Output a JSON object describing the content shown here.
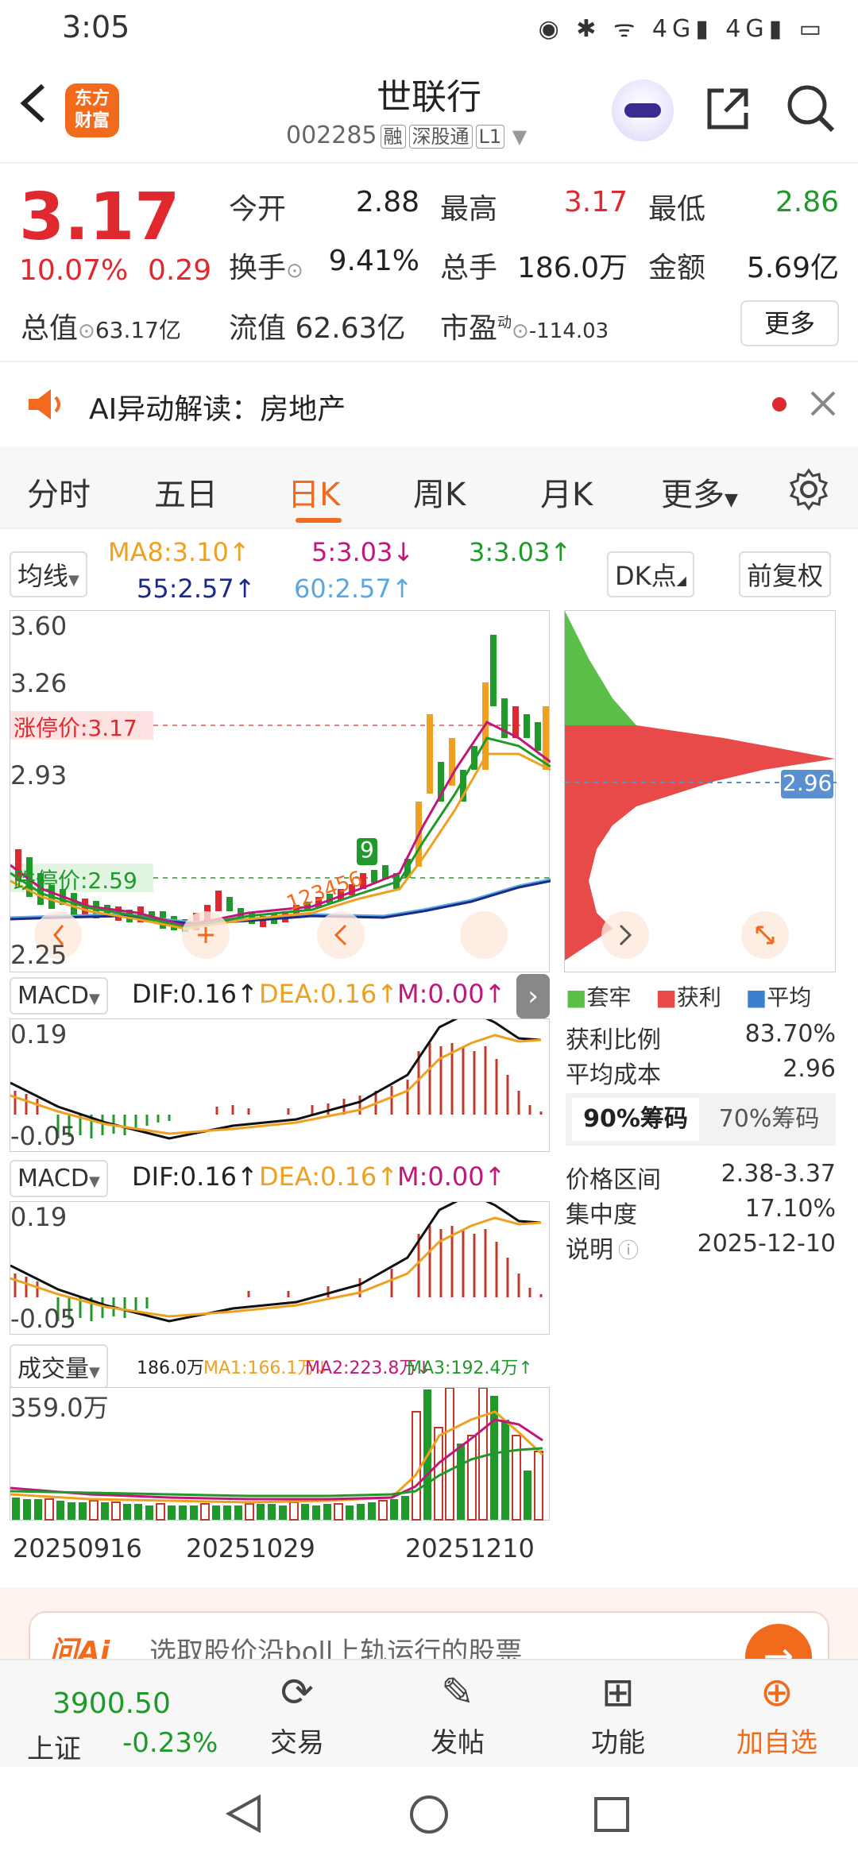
{
  "status": {
    "time": "3:05",
    "icons": "◉ ✱ ᯤ 4G▮ 4G▮ ▭"
  },
  "header": {
    "back_icon": "chevron-left-icon",
    "logo_line1": "东方",
    "logo_line2": "财富",
    "title": "世联行",
    "code": "002285",
    "tags": [
      "融",
      "深股通",
      "L1"
    ]
  },
  "quote": {
    "price": "3.17",
    "change_pct": "10.07%",
    "change": "0.29",
    "open_label": "今开",
    "open": "2.88",
    "high_label": "最高",
    "high": "3.17",
    "low_label": "最低",
    "low": "2.86",
    "turnover_label": "换手",
    "turnover": "9.41%",
    "volume_label": "总手",
    "volume": "186.0万",
    "amount_label": "金额",
    "amount": "5.69亿",
    "mktcap_label": "总值",
    "mktcap": "63.17亿",
    "float_label": "流值",
    "float": "62.63亿",
    "pe_label": "市盈",
    "pe_sup": "动",
    "pe": "-114.03",
    "more": "更多"
  },
  "ai": {
    "text": "AI异动解读：房地产"
  },
  "tabs": [
    "分时",
    "五日",
    "日K",
    "周K",
    "月K",
    "更多"
  ],
  "ma": {
    "selector": "均线",
    "ma8": "MA8:3.10↑",
    "ma5": "5:3.03↓",
    "ma3": "3:3.03↑",
    "ma55": "55:2.57↑",
    "ma60": "60:2.57↑",
    "dk": "DK点",
    "adjust": "前复权"
  },
  "kline": {
    "y_top": "3.60",
    "y_2": "3.26",
    "y_3": "2.93",
    "y_low": "2.25",
    "limit_up": "涨停价:3.17",
    "limit_down": "跌停价:2.59",
    "marker": "9",
    "seq": "123456"
  },
  "macd1": {
    "name": "MACD",
    "dif": "DIF:0.16↑",
    "dea": "DEA:0.16↑",
    "m": "M:0.00↑",
    "y_top": "0.19",
    "y_low": "-0.05"
  },
  "macd2": {
    "name": "MACD",
    "dif": "DIF:0.16↑",
    "dea": "DEA:0.16↑",
    "m": "M:0.00↑",
    "y_top": "0.19",
    "y_low": "-0.05"
  },
  "vol": {
    "name": "成交量",
    "v": "186.0万",
    "ma1": "MA1:166.1万↓",
    "ma2": "MA2:223.8万↓",
    "ma3": "MA3:192.4万↑",
    "y_top": "359.0万",
    "dates": [
      "20250916",
      "20251029",
      "20251210"
    ]
  },
  "chip": {
    "current": "2.96",
    "legend": [
      "套牢",
      "获利",
      "平均"
    ],
    "profit_label": "获利比例",
    "profit": "83.70%",
    "avg_label": "平均成本",
    "avg": "2.96",
    "tab90": "90%筹码",
    "tab70": "70%筹码",
    "range_label": "价格区间",
    "range": "2.38-3.37",
    "conc_label": "集中度",
    "conc": "17.10%",
    "note_label": "说明",
    "note": "2025-12-10"
  },
  "promo": {
    "logo": "问Ai",
    "text": "选取股价沿boll上轨运行的股票"
  },
  "bottom": {
    "index_value": "3900.50",
    "index_name": "上证",
    "index_change": "-0.23%",
    "trade": "交易",
    "post": "发帖",
    "func": "功能",
    "add": "加自选"
  },
  "colors": {
    "up": "#e0292e",
    "down": "#1f9a2a",
    "accent": "#f26b1d"
  }
}
